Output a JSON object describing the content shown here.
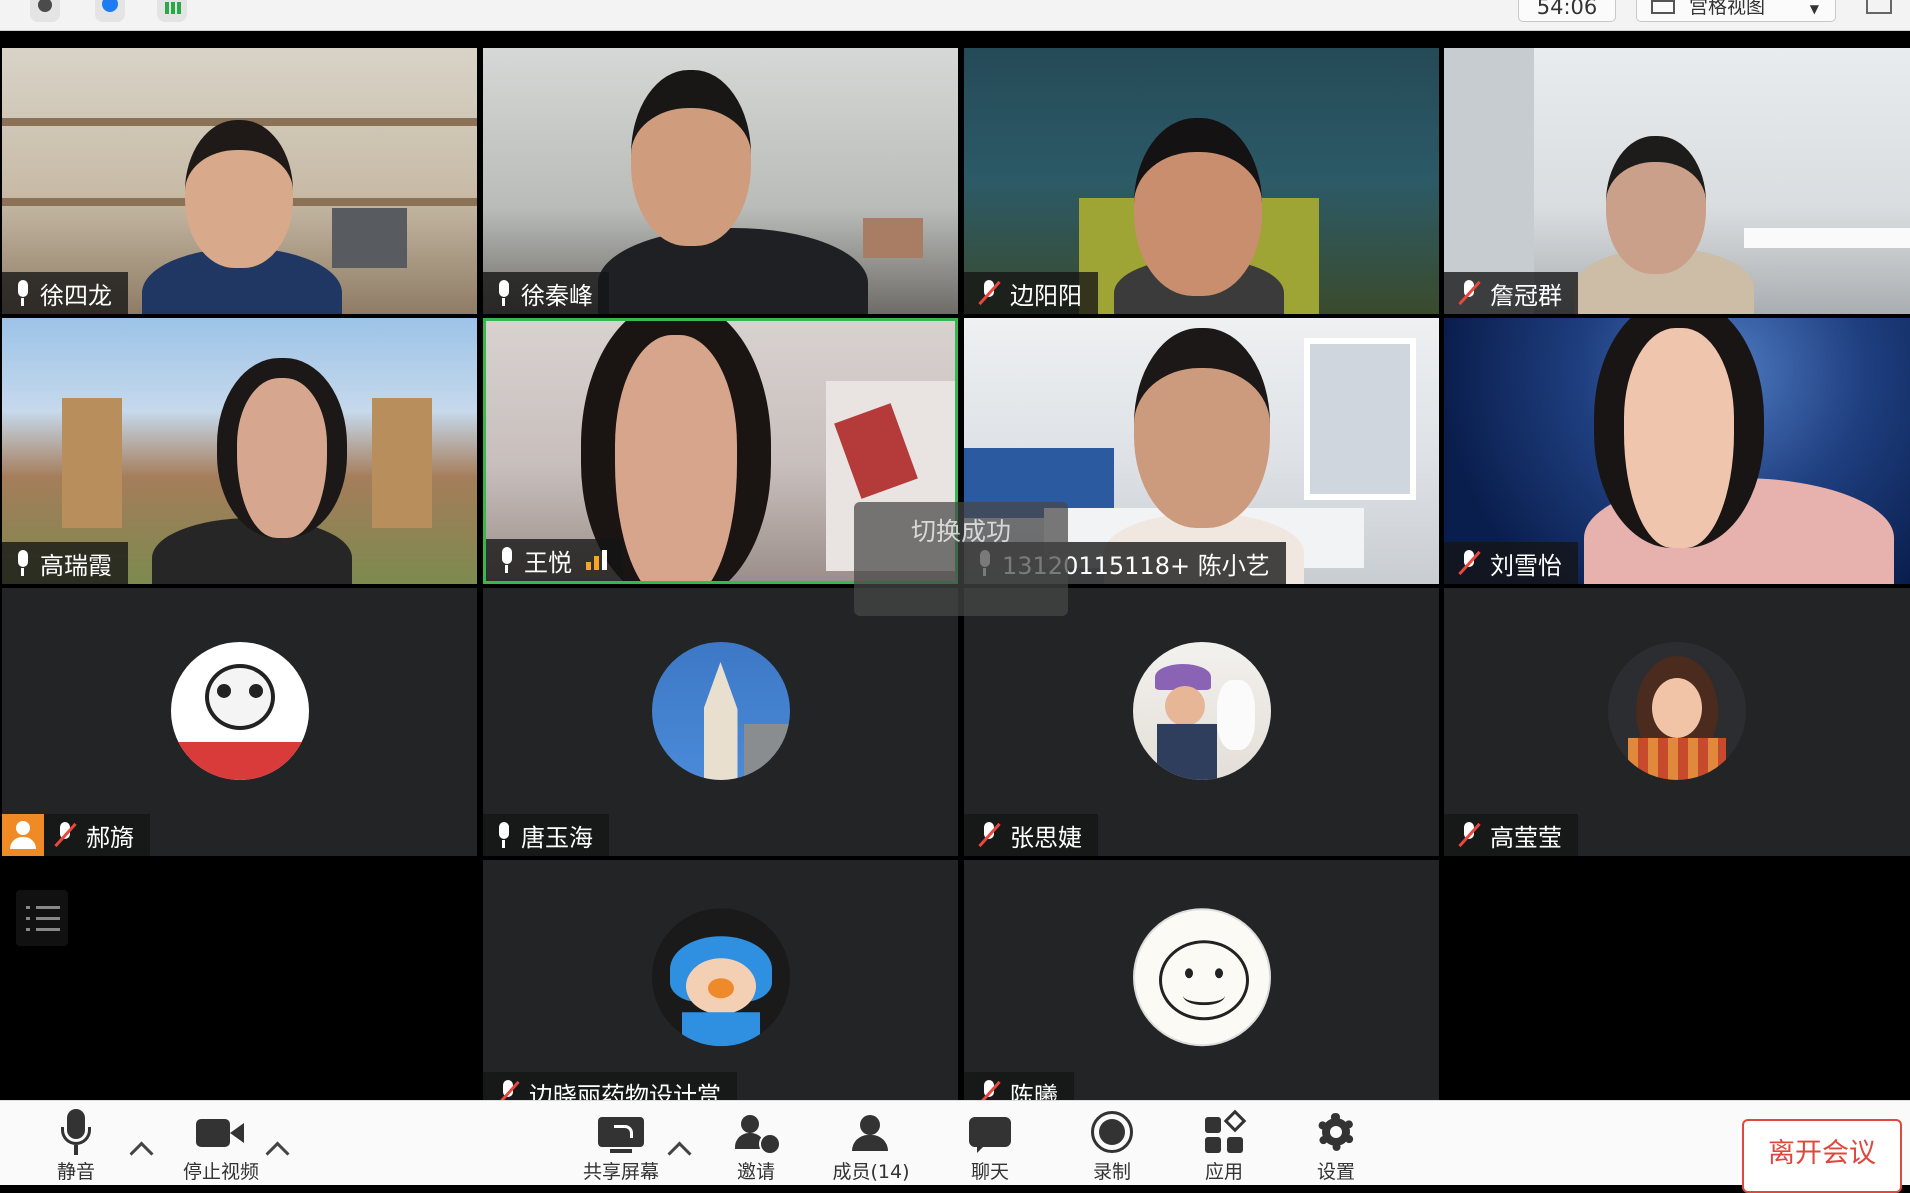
{
  "topbar": {
    "timer": "54:06",
    "view_mode": "宫格视图"
  },
  "tiles": [
    {
      "name": "徐四龙",
      "muted": false
    },
    {
      "name": "徐秦峰",
      "muted": false
    },
    {
      "name": "边阳阳",
      "muted": true
    },
    {
      "name": "詹冠群",
      "muted": true
    },
    {
      "name": "高瑞霞",
      "muted": false
    },
    {
      "name": "王悦",
      "muted": false,
      "speaking": true
    },
    {
      "name": "13120115118+ 陈小艺",
      "muted": false
    },
    {
      "name": "刘雪怡",
      "muted": true
    },
    {
      "name": "郝旖",
      "muted": true
    },
    {
      "name": "唐玉海",
      "muted": false
    },
    {
      "name": "张思婕",
      "muted": true
    },
    {
      "name": "高莹莹",
      "muted": true
    },
    {
      "name": "边晓丽药物设计赏",
      "muted": true
    },
    {
      "name": "陈曦",
      "muted": true
    }
  ],
  "toast": "切换成功",
  "toolbar": {
    "mute": "静音",
    "stop_video": "停止视频",
    "share_screen": "共享屏幕",
    "invite": "邀请",
    "participants": "成员(14)",
    "chat": "聊天",
    "record": "录制",
    "apps": "应用",
    "settings": "设置",
    "leave": "离开会议"
  },
  "colors": {
    "leave_red": "#e0483d",
    "speaking_border": "#35b84f",
    "muted_red": "#e8483d",
    "tile_bg": "#232426"
  }
}
